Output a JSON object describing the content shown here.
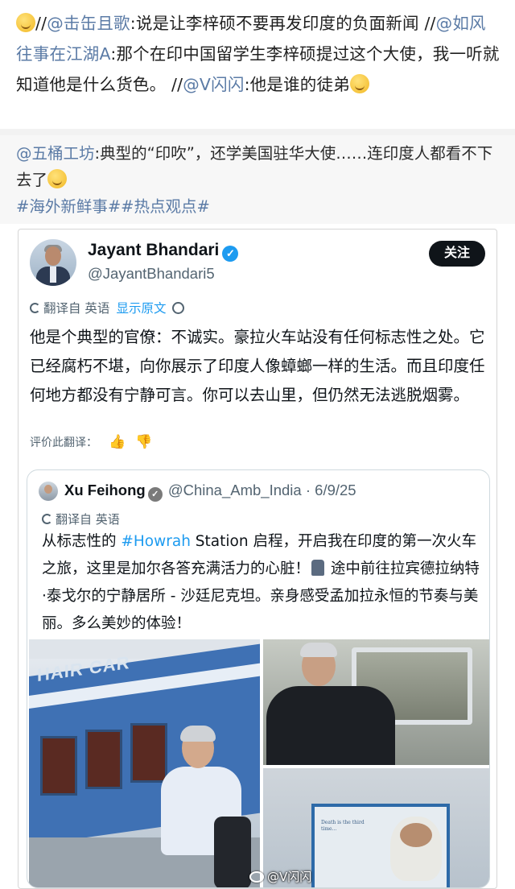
{
  "repost": {
    "segments": [
      {
        "type": "text",
        "value": "//"
      },
      {
        "type": "link",
        "value": "@击缶且歌"
      },
      {
        "type": "text",
        "value": ":说是让李梓硕不要再发印度的负面新闻 //"
      },
      {
        "type": "link",
        "value": "@如风往事在江湖A"
      },
      {
        "type": "text",
        "value": ":那个在印中国留学生李梓硕提过这个大使，我一听就知道他是什么货色。 //"
      },
      {
        "type": "link",
        "value": "@V闪闪"
      },
      {
        "type": "text",
        "value": ":他是谁的徒弟"
      }
    ]
  },
  "comment": {
    "user": "@五桶工坊",
    "text": ":典型的“印吹”，还学美国驻华大使……连印度人都看不下去了",
    "hashtags": "#海外新鲜事##热点观点#"
  },
  "tweet": {
    "author_name": "Jayant Bhandari",
    "author_handle": "@JayantBhandari5",
    "follow_label": "关注",
    "translated_from": "翻译自 英语",
    "show_original": "显示原文",
    "body": "他是个典型的官僚：不诚实。豪拉火车站没有任何标志性之处。它已经腐朽不堪，向你展示了印度人像蟑螂一样的生活。而且印度任何地方都没有宁静可言。你可以去山里，但仍然无法逃脱烟雾。",
    "rate_label": "评价此翻译："
  },
  "quote": {
    "author_name": "Xu Feihong",
    "author_handle": "@China_Amb_India · 6/9/25",
    "translated_from": "翻译自 英语",
    "body_pre": "从标志性的 ",
    "hashtag": "#Howrah",
    "body_mid": " Station 启程，开启我在印度的第一次火车之旅，这里是加尔各答充满活力的心脏！",
    "body_post": " 途中前往拉宾德拉纳特·泰戈尔的宁静居所 - 沙廷尼克坦。亲身感受孟加拉永恒的节奏与美丽。多么美妙的体验！",
    "photo_train_text": "HAIR CAR",
    "photo_poster_text": "Death is the third time..."
  },
  "watermark": "@V闪闪",
  "colors": {
    "link": "#5b7ba6",
    "twitter_blue": "#1d9bf0",
    "follow_bg": "#0f1419"
  },
  "icons": [
    "grin-sweat-emoji",
    "smirk-emoji",
    "verified-badge-icon",
    "globe-icon",
    "gear-icon",
    "thumbs-up-icon",
    "thumbs-down-icon",
    "train-emoji",
    "weibo-logo-icon"
  ]
}
